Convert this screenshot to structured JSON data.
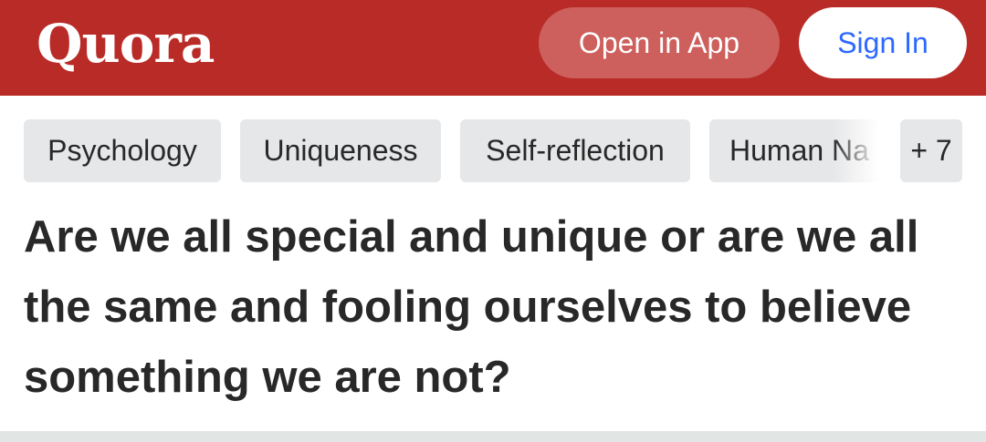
{
  "header": {
    "logo": "Quora",
    "open_in_app_label": "Open in App",
    "sign_in_label": "Sign In",
    "background_color": "#b92b27"
  },
  "topics": {
    "items": [
      {
        "label": "Psychology"
      },
      {
        "label": "Uniqueness"
      },
      {
        "label": "Self-reflection"
      },
      {
        "label": "Human Na"
      }
    ],
    "more_label": "+ 7"
  },
  "question": {
    "title": "Are we all special and unique or are we all the same and fooling ourselves to believe something we are not?"
  }
}
